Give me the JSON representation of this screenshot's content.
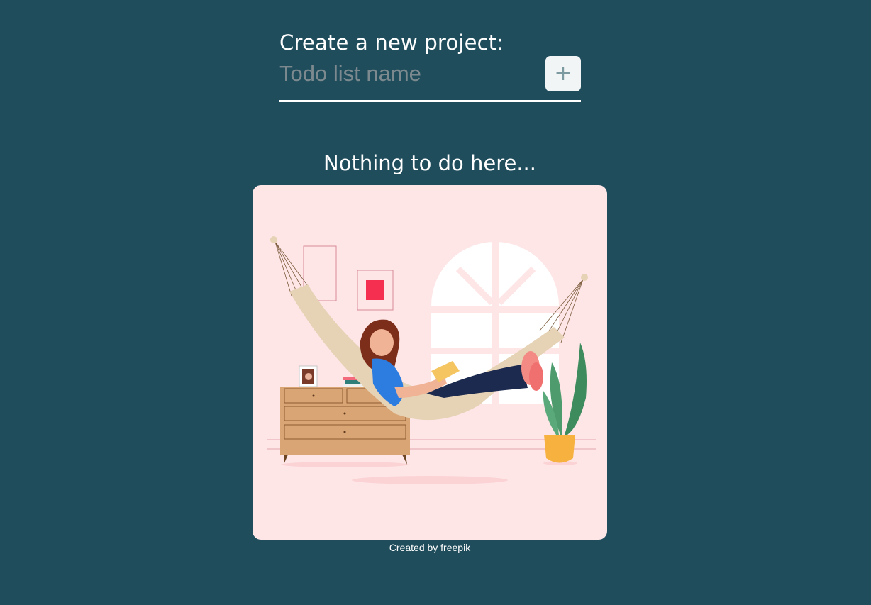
{
  "create_project": {
    "heading": "Create a new project:",
    "input_placeholder": "Todo list name",
    "input_value": "",
    "add_button_label": "+"
  },
  "empty_state": {
    "title": "Nothing to do here...",
    "illustration_icon": "woman-reading-in-hammock-illustration",
    "credit": "Created by freepik"
  },
  "colors": {
    "background": "#204d5c",
    "card_background": "#fee6e7",
    "button_background": "#f1f5f6",
    "text": "#ffffff"
  }
}
